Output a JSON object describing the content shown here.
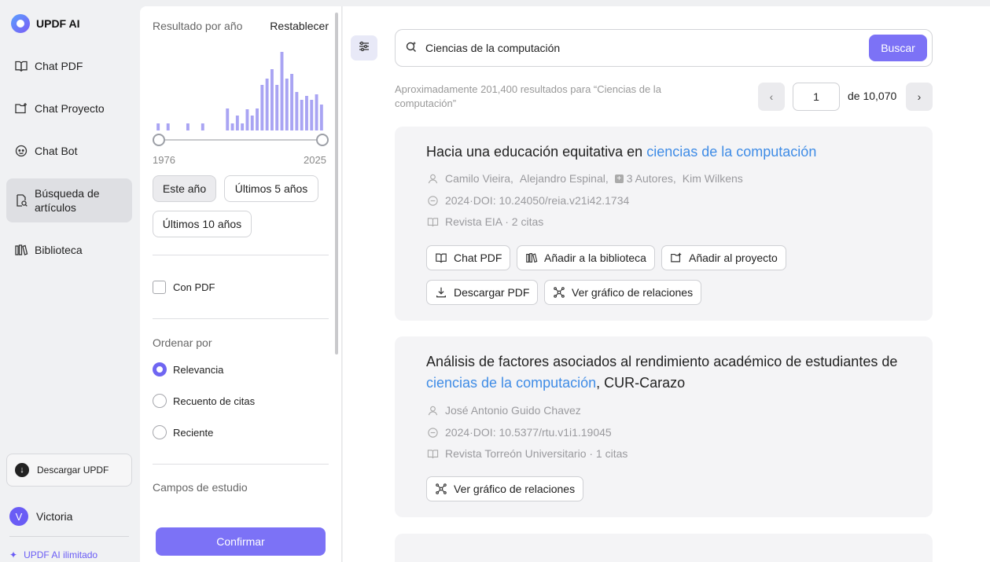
{
  "app": {
    "name": "UPDF AI"
  },
  "nav": {
    "items": [
      {
        "label": "Chat PDF",
        "icon": "book-icon"
      },
      {
        "label": "Chat Proyecto",
        "icon": "folder-plus-icon"
      },
      {
        "label": "Chat Bot",
        "icon": "bot-icon"
      },
      {
        "label": "Búsqueda de artículos",
        "icon": "article-search-icon",
        "active": true
      },
      {
        "label": "Biblioteca",
        "icon": "library-icon"
      }
    ],
    "download_label": "Descargar UPDF",
    "user_initial": "V",
    "user_name": "Victoria",
    "unlimited_label": "UPDF AI ilimitado"
  },
  "filters": {
    "year_heading": "Resultado por año",
    "reset_label": "Restablecer",
    "year_min": "1976",
    "year_max": "2025",
    "histogram": [
      0.09,
      0,
      0.09,
      0,
      0,
      0,
      0.09,
      0,
      0,
      0.09,
      0,
      0,
      0,
      0,
      0.28,
      0.09,
      0.19,
      0.09,
      0.27,
      0.19,
      0.28,
      0.58,
      0.66,
      0.78,
      0.58,
      1.0,
      0.66,
      0.72,
      0.49,
      0.39,
      0.44,
      0.39,
      0.46,
      0.33
    ],
    "time_chips": [
      "Este año",
      "Últimos 5 años",
      "Últimos 10 años"
    ],
    "selected_chip": "Este año",
    "pdf_label": "Con PDF",
    "pdf_checked": false,
    "sort_heading": "Ordenar por",
    "sort_options": [
      "Relevancia",
      "Recuento de citas",
      "Reciente"
    ],
    "sort_selected": "Relevancia",
    "fields_heading": "Campos de estudio",
    "confirm_label": "Confirmar"
  },
  "search": {
    "query": "Ciencias de la computación",
    "button_label": "Buscar",
    "results_text": "Aproximadamente 201,400 resultados para “Ciencias de la computación”",
    "page": "1",
    "page_total": "de 10,070"
  },
  "results": [
    {
      "title_pre": "Hacia una educación equitativa en ",
      "title_hl": "ciencias de la computación",
      "title_post": "",
      "author1": "Camilo Vieira,",
      "author2": "Alejandro Espinal,",
      "more_authors": "3 Autores,",
      "author3": "Kim Wilkens",
      "doi": "2024·DOI: 10.24050/reia.v21i42.1734",
      "journal": "Revista EIA · 2 citas",
      "actions": [
        "Chat PDF",
        "Añadir a la biblioteca",
        "Añadir al proyecto",
        "Descargar PDF",
        "Ver gráfico de relaciones"
      ]
    },
    {
      "title_pre": "Análisis de factores asociados al rendimiento académico de estudiantes de ",
      "title_hl": "ciencias de la computación",
      "title_post": ", CUR-Carazo",
      "author1": "José Antonio Guido Chavez",
      "doi": "2024·DOI: 10.5377/rtu.v1i1.19045",
      "journal": "Revista Torreón Universitario · 1 citas",
      "actions": [
        "Ver gráfico de relaciones"
      ]
    }
  ]
}
